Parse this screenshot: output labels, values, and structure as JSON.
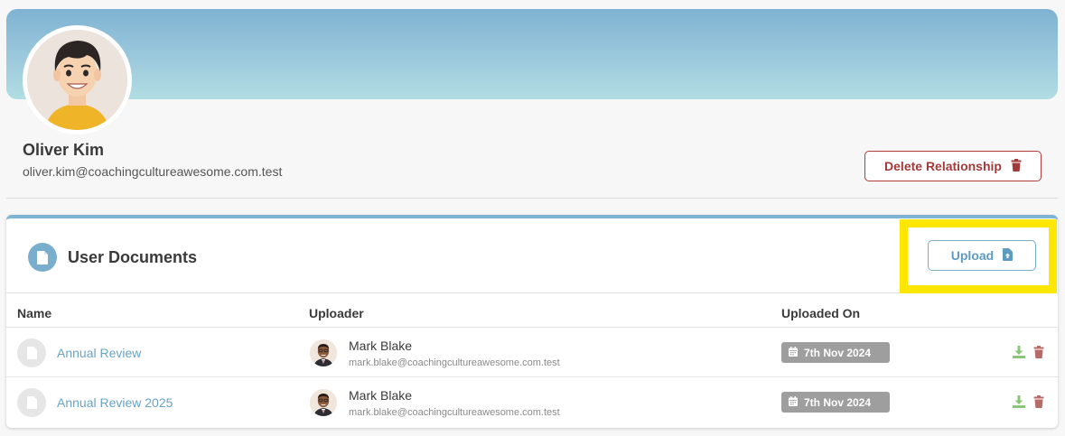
{
  "profile": {
    "name": "Oliver Kim",
    "email": "oliver.kim@coachingcultureawesome.com.test",
    "delete_label": "Delete Relationship"
  },
  "documents": {
    "title": "User Documents",
    "upload_label": "Upload",
    "columns": {
      "name": "Name",
      "uploader": "Uploader",
      "uploaded_on": "Uploaded On"
    },
    "rows": [
      {
        "file": "Annual Review",
        "uploader_name": "Mark Blake",
        "uploader_email": "mark.blake@coachingcultureawesome.com.test",
        "date": "7th Nov 2024"
      },
      {
        "file": "Annual Review 2025",
        "uploader_name": "Mark Blake",
        "uploader_email": "mark.blake@coachingcultureawesome.com.test",
        "date": "7th Nov 2024"
      }
    ]
  },
  "icons": {
    "delete": "trash-icon",
    "upload": "file-upload-icon",
    "document": "document-icon",
    "file": "file-icon",
    "calendar": "calendar-icon",
    "download": "download-icon"
  },
  "colors": {
    "accent": "#7fb3d3",
    "danger": "#a33a3a",
    "link": "#6aa3c6",
    "highlight": "#fde700",
    "download": "#8cc47a",
    "delete_icon": "#b86a66",
    "badge": "#9e9e9e"
  }
}
